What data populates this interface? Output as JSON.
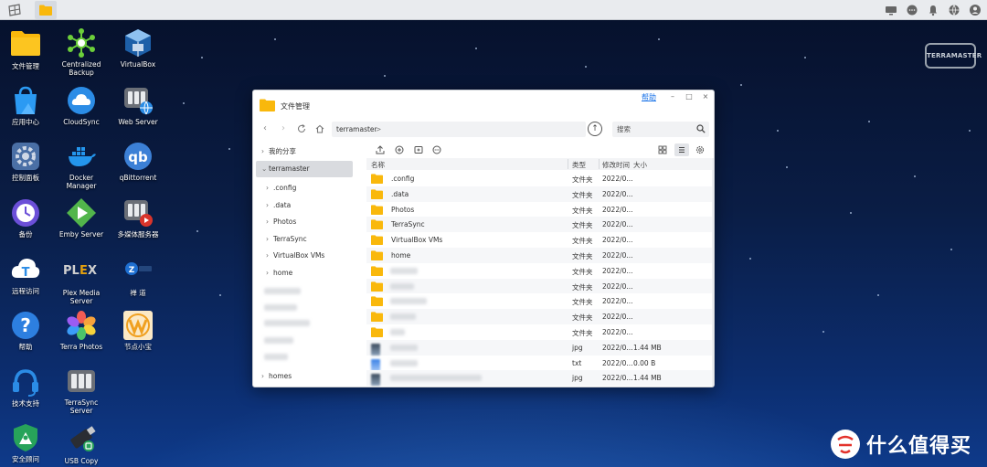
{
  "colors": {
    "folder": "#f9b80c",
    "accent": "#1a73e8",
    "selected": "#d9dbdf"
  },
  "desktop": {
    "icons": [
      {
        "label": "文件管理",
        "icon": "folder-icon"
      },
      {
        "label": "应用中心",
        "icon": "app-center-icon"
      },
      {
        "label": "控制面板",
        "icon": "control-panel-icon"
      },
      {
        "label": "备份",
        "icon": "backup-icon"
      },
      {
        "label": "远程访问",
        "icon": "remote-access-icon"
      },
      {
        "label": "帮助",
        "icon": "help-icon"
      },
      {
        "label": "技术支持",
        "icon": "tech-support-icon"
      },
      {
        "label": "安全顾问",
        "icon": "security-advisor-icon"
      },
      {
        "label": "Centralized\nBackup",
        "icon": "centralized-backup-icon"
      },
      {
        "label": "CloudSync",
        "icon": "cloudsync-icon"
      },
      {
        "label": "Docker\nManager",
        "icon": "docker-icon"
      },
      {
        "label": "Emby Server",
        "icon": "emby-icon"
      },
      {
        "label": "Plex Media\nServer",
        "icon": "plex-icon"
      },
      {
        "label": "Terra Photos",
        "icon": "terra-photos-icon"
      },
      {
        "label": "TerraSync\nServer",
        "icon": "terrasync-icon"
      },
      {
        "label": "USB Copy",
        "icon": "usb-copy-icon"
      },
      {
        "label": "VirtualBox",
        "icon": "virtualbox-icon"
      },
      {
        "label": "Web Server",
        "icon": "web-server-icon"
      },
      {
        "label": "qBittorrent",
        "icon": "qbittorrent-icon"
      },
      {
        "label": "多媒体服务器",
        "icon": "media-server-icon"
      },
      {
        "label": "禅 道",
        "icon": "zentao-icon"
      },
      {
        "label": "节点小宝",
        "icon": "node-icon"
      }
    ],
    "brand_logo": "TERRAMASTER",
    "watermark": "什么值得买",
    "plex_logo": "PLEX",
    "qb_logo": "qb"
  },
  "window": {
    "title": "文件管理",
    "help_label": "帮助",
    "controls": {
      "min": "–",
      "max": "□",
      "close": "×"
    },
    "address": {
      "path": "terramaster",
      "separator": ">"
    },
    "search_placeholder": "搜索",
    "sidebar": {
      "top": "我的分享",
      "root": "terramaster",
      "children": [
        ".config",
        ".data",
        "Photos",
        "TerraSync",
        "VirtualBox VMs",
        "home"
      ],
      "bottom": "homes"
    },
    "columns": {
      "name": "名称",
      "type": "类型",
      "modified": "修改时间",
      "size": "大小"
    },
    "files": [
      {
        "name": ".config",
        "type": "文件夹",
        "modified": "2022/0...",
        "size": "",
        "kind": "folder"
      },
      {
        "name": ".data",
        "type": "文件夹",
        "modified": "2022/0...",
        "size": "",
        "kind": "folder"
      },
      {
        "name": "Photos",
        "type": "文件夹",
        "modified": "2022/0...",
        "size": "",
        "kind": "folder"
      },
      {
        "name": "TerraSync",
        "type": "文件夹",
        "modified": "2022/0...",
        "size": "",
        "kind": "folder"
      },
      {
        "name": "VirtualBox VMs",
        "type": "文件夹",
        "modified": "2022/0...",
        "size": "",
        "kind": "folder"
      },
      {
        "name": "home",
        "type": "文件夹",
        "modified": "2022/0...",
        "size": "",
        "kind": "folder"
      },
      {
        "name": "",
        "type": "文件夹",
        "modified": "2022/0...",
        "size": "",
        "kind": "folder-blur"
      },
      {
        "name": "",
        "type": "文件夹",
        "modified": "2022/0...",
        "size": "",
        "kind": "folder-blur"
      },
      {
        "name": "",
        "type": "文件夹",
        "modified": "2022/0...",
        "size": "",
        "kind": "folder-blur"
      },
      {
        "name": "",
        "type": "文件夹",
        "modified": "2022/0...",
        "size": "",
        "kind": "folder-blur"
      },
      {
        "name": "",
        "type": "文件夹",
        "modified": "2022/0...",
        "size": "",
        "kind": "folder-blur"
      },
      {
        "name": "",
        "type": "jpg",
        "modified": "2022/0...",
        "size": "1.44 MB",
        "kind": "image-blur"
      },
      {
        "name": "",
        "type": "txt",
        "modified": "2022/0...",
        "size": "0.00 B",
        "kind": "text-blur"
      },
      {
        "name": "",
        "type": "jpg",
        "modified": "2022/0...",
        "size": "1.44 MB",
        "kind": "image-blur"
      }
    ]
  }
}
